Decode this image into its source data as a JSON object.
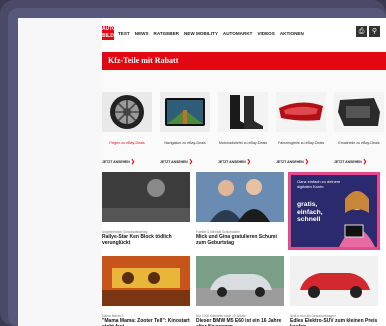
{
  "nav": {
    "logo_text": "AUTO BILD",
    "items": [
      "TEST",
      "NEWS",
      "RATGEBER",
      "NEW MOBILITY",
      "AUTOMARKT",
      "VIDEOS",
      "AKTIONEN"
    ],
    "icons": [
      "print-icon",
      "search-icon"
    ]
  },
  "ad": {
    "banner": "Kfz-Teile mit Rabatt",
    "products": [
      {
        "name": "Felgen zu eBay-Deals",
        "cta": "JETZT ANSEHEN"
      },
      {
        "name": "Navigation zu eBay-Deals",
        "cta": "JETZT ANSEHEN"
      },
      {
        "name": "Motorradstiefel zu eBay-Deals",
        "cta": "JETZT ANSEHEN"
      },
      {
        "name": "Fahrzeugteile zu eBay-Deals",
        "cta": "JETZT ANSEHEN"
      },
      {
        "name": "Ersatzteile zu eBay-Deals",
        "cta": "JETZT ANSEHEN"
      }
    ]
  },
  "articles": [
    {
      "kicker": "Ungebremster Schicksalsschlag",
      "title": "Rallye-Star Ken Block tödlich verunglückt"
    },
    {
      "kicker": "Familie & Michael Schumacher",
      "title": "Mick und Gina gratulieren Schumi zum Geburtstag"
    },
    {
      "kicker": "Mama Mama 2",
      "title": "\"Mama Mama: Zooter Tell\": Kinostart steht fest"
    },
    {
      "kicker": "Nur 1000 Kilometer nach 10 Jahren",
      "title": "Dieser BMW M5 E60 ist ein 16 Jahre alter Neuwagen"
    },
    {
      "kicker": "Audi e-tron als Gebrauchtwagen",
      "title": "Edles Elektro-SUV zum kleinen Preis kaufen"
    }
  ],
  "promo": {
    "small_text": "Ganz einfach zu deinem digitalen Konto",
    "big_text": "gratis, einfach, schnell"
  }
}
